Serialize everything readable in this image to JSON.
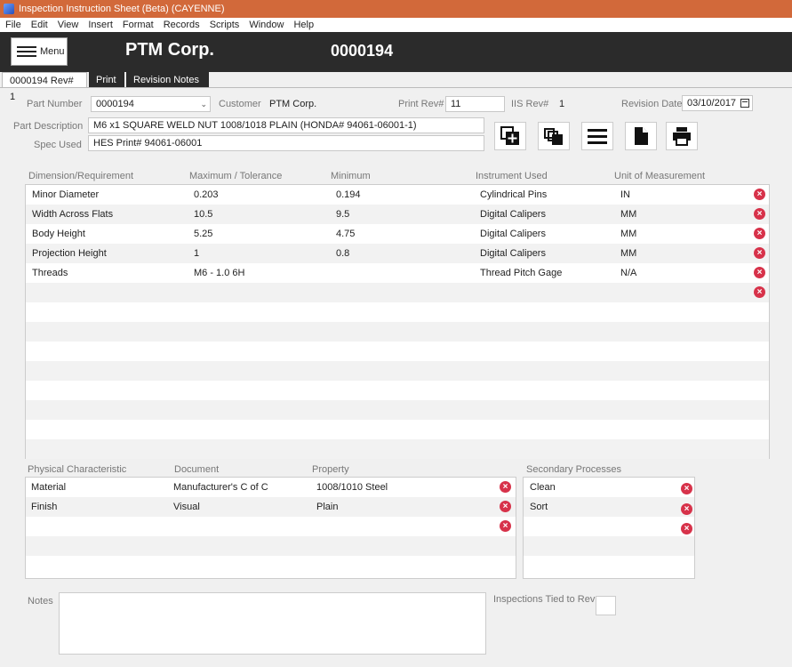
{
  "window": {
    "title": "Inspection Instruction Sheet (Beta) (CAYENNE)"
  },
  "menubar": [
    "File",
    "Edit",
    "View",
    "Insert",
    "Format",
    "Records",
    "Scripts",
    "Window",
    "Help"
  ],
  "header": {
    "menu_label": "Menu",
    "company": "PTM Corp.",
    "number": "0000194"
  },
  "tabs": [
    "0000194 Rev# 1",
    "Print",
    "Revision Notes"
  ],
  "form": {
    "part_number_label": "Part Number",
    "part_number": "0000194",
    "customer_label": "Customer",
    "customer": "PTM Corp.",
    "print_rev_label": "Print Rev#",
    "print_rev": "11",
    "iis_rev_label": "IIS Rev#",
    "iis_rev": "1",
    "revision_date_label": "Revision Date",
    "revision_date": "03/10/2017",
    "part_description_label": "Part Description",
    "part_description": "M6 x1 SQUARE WELD NUT 1008/1018 PLAIN (HONDA# 94061-06001-1)",
    "spec_used_label": "Spec Used",
    "spec_used": "HES Print# 94061-06001"
  },
  "toolbar_icons": [
    "add-record-icon",
    "duplicate-icon",
    "list-icon",
    "document-icon",
    "print-icon"
  ],
  "dimensions": {
    "headers": [
      "Dimension/Requirement",
      "Maximum / Tolerance",
      "Minimum",
      "Instrument Used",
      "Unit of Measurement"
    ],
    "rows": [
      [
        "Minor Diameter",
        "0.203",
        "0.194",
        "Cylindrical Pins",
        "IN"
      ],
      [
        "Width Across Flats",
        "10.5",
        "9.5",
        "Digital Calipers",
        "MM"
      ],
      [
        "Body Height",
        "5.25",
        "4.75",
        "Digital Calipers",
        "MM"
      ],
      [
        "Projection Height",
        "1",
        "0.8",
        "Digital Calipers",
        "MM"
      ],
      [
        "Threads",
        "M6 - 1.0 6H",
        "",
        "Thread Pitch Gage",
        "N/A"
      ]
    ]
  },
  "physical": {
    "headers": [
      "Physical Characteristic",
      "Document",
      "Property"
    ],
    "rows": [
      [
        "Material",
        "Manufacturer's C of C",
        "1008/1010 Steel"
      ],
      [
        "Finish",
        "Visual",
        "Plain"
      ]
    ]
  },
  "secondary": {
    "header": "Secondary Processes",
    "rows": [
      "Clean",
      "Sort"
    ]
  },
  "footer": {
    "notes_label": "Notes",
    "inspections_label": "Inspections Tied to Rev:"
  },
  "delete_glyph": "×"
}
